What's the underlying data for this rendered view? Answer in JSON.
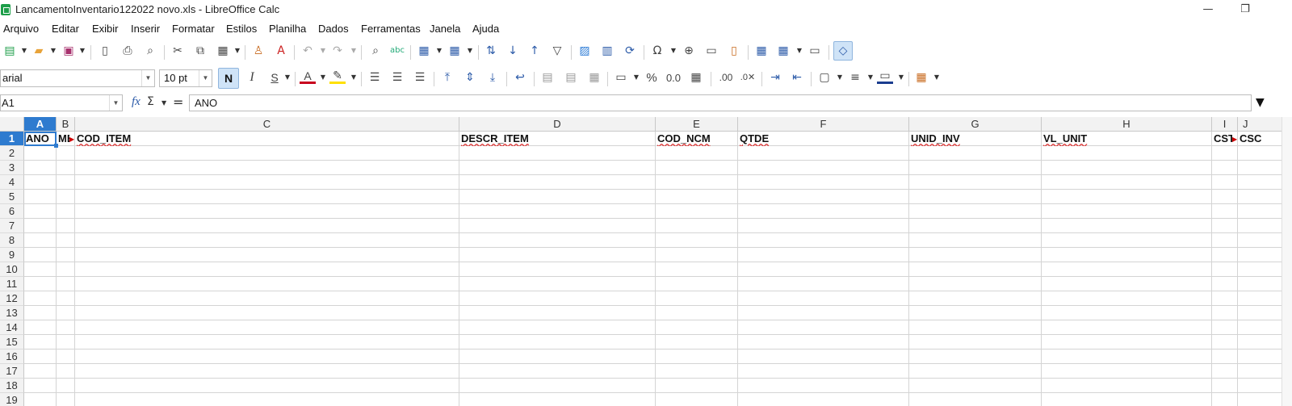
{
  "window": {
    "title": "LancamentoInventario122022 novo.xls - LibreOffice Calc",
    "minimize": "—",
    "restore": "❐"
  },
  "menu": [
    "Arquivo",
    "Editar",
    "Exibir",
    "Inserir",
    "Formatar",
    "Estilos",
    "Planilha",
    "Dados",
    "Ferramentas",
    "Janela",
    "Ajuda"
  ],
  "format_toolbar": {
    "font_name": "arial",
    "font_size": "10 pt",
    "bold": "N",
    "italic": "I",
    "underline": "S",
    "font_color_glyph": "A",
    "percent": "%",
    "number_format": "0.0",
    "add_decimal": ".00",
    "remove_decimal": ".0✕"
  },
  "formula_bar": {
    "cell_ref": "A1",
    "fx": "fx",
    "sigma": "Σ",
    "equals": "=",
    "content": "ANO"
  },
  "columns": [
    "A",
    "B",
    "C",
    "D",
    "E",
    "F",
    "G",
    "H",
    "I",
    "J"
  ],
  "rows": [
    "1",
    "2",
    "3",
    "4",
    "5",
    "6",
    "7",
    "8",
    "9",
    "10",
    "11",
    "12",
    "13",
    "14",
    "15",
    "16",
    "17",
    "18",
    "19"
  ],
  "row1_cells": [
    "ANO",
    "ME",
    "COD_ITEM",
    "DESCR_ITEM",
    "COD_NCM",
    "QTDE",
    "UNID_INV",
    "VL_UNIT",
    "CST",
    "CSC"
  ],
  "selected_cell": "A1",
  "colors": {
    "selection": "#2e7bcf",
    "app_icon": "#1e9e4a",
    "spell_underline": "#d33"
  },
  "icons": [
    "new-document-icon",
    "open-folder-icon",
    "save-icon",
    "export-pdf-icon",
    "print-icon",
    "print-preview-icon",
    "cut-icon",
    "copy-icon",
    "paste-icon",
    "clone-formatting-icon",
    "clear-formatting-icon",
    "undo-icon",
    "redo-icon",
    "find-replace-icon",
    "spelling-icon",
    "row-icon",
    "column-icon",
    "sort-icon",
    "sort-ascending-icon",
    "sort-descending-icon",
    "autofilter-icon",
    "image-icon",
    "chart-icon",
    "pivot-table-icon",
    "special-character-icon",
    "hyperlink-icon",
    "comment-icon",
    "headers-footers-icon",
    "freeze-icon",
    "split-window-icon",
    "show-draw-functions-icon"
  ]
}
